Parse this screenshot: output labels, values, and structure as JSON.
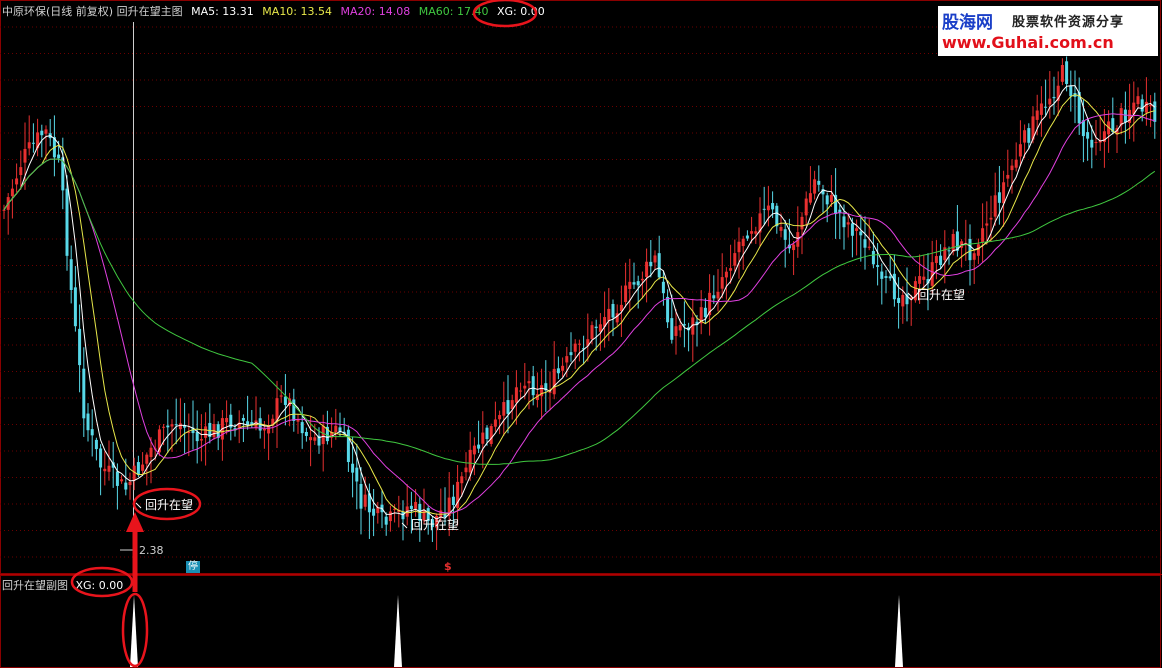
{
  "header": {
    "title": "中原环保(日线 前复权) 回升在望主图",
    "ma5": "MA5: 13.31",
    "ma10": "MA10: 13.54",
    "ma20": "MA20: 14.08",
    "ma60": "MA60: 17.40",
    "xg": "XG: 0.00"
  },
  "sub_header": {
    "title": "回升在望副图",
    "xg": "XG: 0.00"
  },
  "logo": {
    "name": "股海网",
    "slogan": "股票软件资源分享",
    "url": "www.Guhai.com.cn"
  },
  "chart": {
    "signal_label": "回升在望",
    "low_price_label": "2.38",
    "halt_tag": "停",
    "s_tag": "$"
  },
  "colors": {
    "background": "#000000",
    "grid": "#6a0000",
    "up": "#e83030",
    "down": "#58d8e8",
    "ma5": "#ffffff",
    "ma10": "#e8e84a",
    "ma20": "#e040e0",
    "ma60": "#40c840",
    "annotation": "#e8141c",
    "header_title": "#d0d0d0"
  }
}
